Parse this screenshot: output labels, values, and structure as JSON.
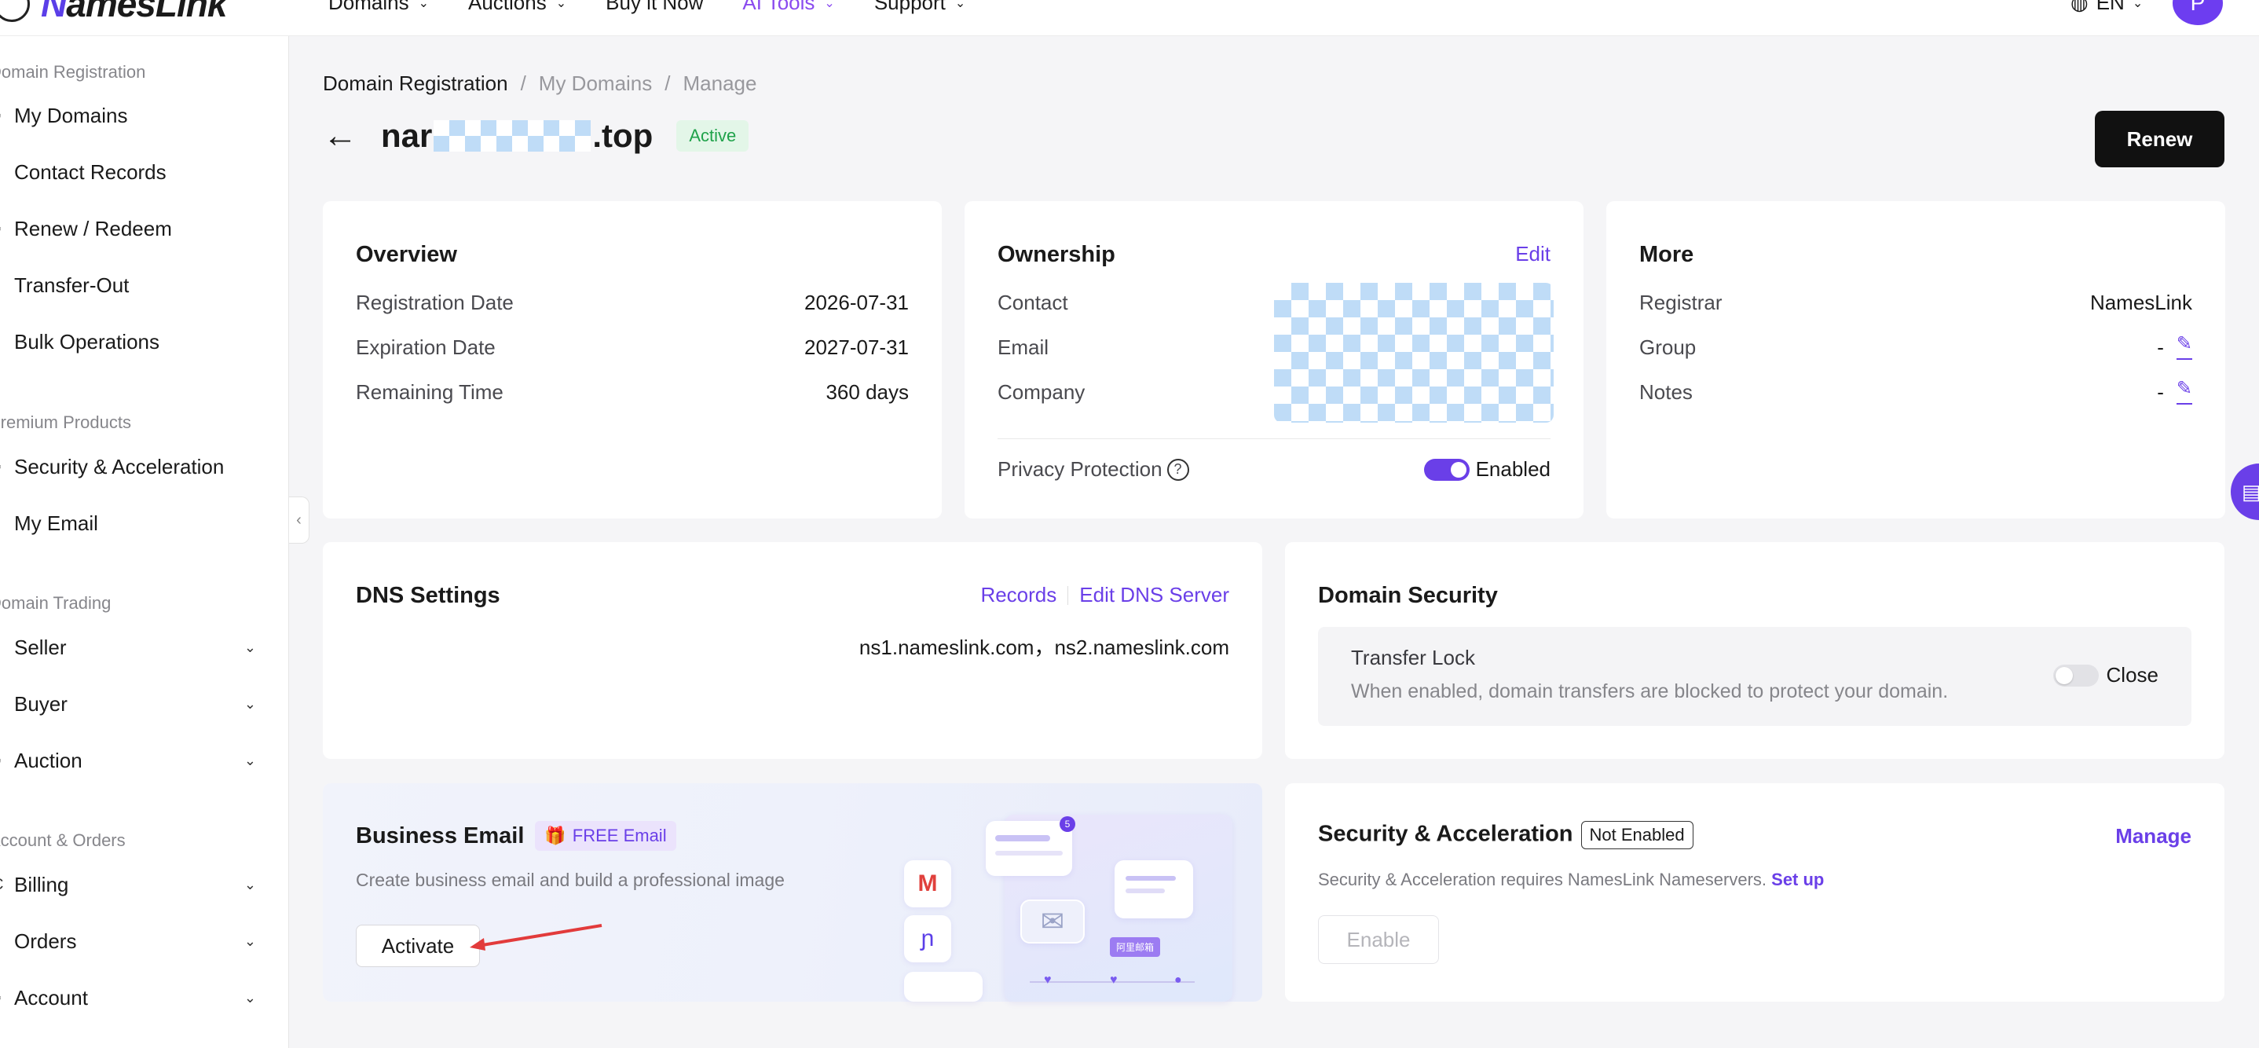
{
  "topbar": {
    "logo_text_accent": "N",
    "logo_text": "amesLink",
    "nav": [
      {
        "label": "Domains"
      },
      {
        "label": "Auctions"
      },
      {
        "label": "Buy it Now"
      },
      {
        "label": "AI Tools"
      },
      {
        "label": "Support"
      }
    ],
    "lang": "EN",
    "avatar_initial": "P"
  },
  "sidebar": {
    "groups": [
      {
        "title": "Domain Registration",
        "items": [
          {
            "label": "My Domains"
          },
          {
            "label": "Contact Records"
          },
          {
            "label": "Renew / Redeem"
          },
          {
            "label": "Transfer-Out"
          },
          {
            "label": "Bulk Operations"
          }
        ]
      },
      {
        "title": "Premium Products",
        "items": [
          {
            "label": "Security & Acceleration"
          },
          {
            "label": "My Email"
          }
        ]
      },
      {
        "title": "Domain Trading",
        "items": [
          {
            "label": "Seller"
          },
          {
            "label": "Buyer"
          },
          {
            "label": "Auction"
          }
        ]
      },
      {
        "title": "Account & Orders",
        "items": [
          {
            "label": "Billing"
          },
          {
            "label": "Orders"
          },
          {
            "label": "Account"
          }
        ]
      }
    ]
  },
  "breadcrumb": {
    "first": "Domain Registration",
    "sep": "/",
    "second": "My Domains",
    "third": "Manage"
  },
  "header": {
    "domain_prefix": "nar",
    "domain_suffix": ".top",
    "status": "Active",
    "renew_label": "Renew"
  },
  "overview": {
    "title": "Overview",
    "rows": [
      {
        "k": "Registration Date",
        "v": "2026-07-31"
      },
      {
        "k": "Expiration Date",
        "v": "2027-07-31"
      },
      {
        "k": "Remaining Time",
        "v": "360 days"
      }
    ]
  },
  "ownership": {
    "title": "Ownership",
    "edit": "Edit",
    "labels": [
      "Contact",
      "Email",
      "Company"
    ],
    "privacy_label": "Privacy Protection",
    "privacy_state": "Enabled"
  },
  "more": {
    "title": "More",
    "registrar_k": "Registrar",
    "registrar_v": "NamesLink",
    "group_k": "Group",
    "group_v": "-",
    "notes_k": "Notes",
    "notes_v": "-"
  },
  "dns": {
    "title": "DNS Settings",
    "records": "Records",
    "edit_server": "Edit DNS Server",
    "servers": "ns1.nameslink.com，ns2.nameslink.com"
  },
  "domain_security": {
    "title": "Domain Security",
    "lock_title": "Transfer Lock",
    "lock_desc": "When enabled, domain transfers are blocked to protect your domain.",
    "lock_state": "Close"
  },
  "business_email": {
    "title": "Business Email",
    "badge": "FREE Email",
    "desc": "Create business email and build a professional image",
    "activate": "Activate",
    "illus_badge": "阿里邮箱"
  },
  "security_accel": {
    "title": "Security & Acceleration",
    "status": "Not Enabled",
    "manage": "Manage",
    "desc": "Security & Acceleration requires NamesLink Nameservers.",
    "setup": "Set up",
    "enable": "Enable"
  },
  "colors": {
    "accent": "#6a3fe8",
    "active_green": "#1fa24a",
    "renew_bg": "#111111"
  }
}
